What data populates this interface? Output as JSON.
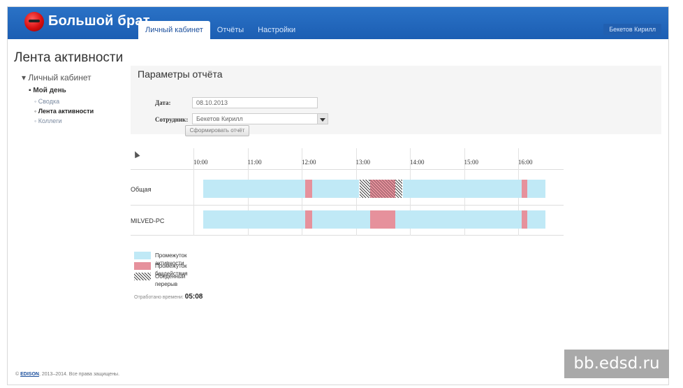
{
  "app": {
    "brand": "Большой брат",
    "tabs": [
      {
        "label": "Личный кабинет",
        "active": true
      },
      {
        "label": "Отчёты",
        "active": false
      },
      {
        "label": "Настройки",
        "active": false
      }
    ],
    "user": "Бекетов Кирилл"
  },
  "page_title": "Лента активности",
  "sidebar": {
    "root": "Личный кабинет",
    "group": "Мой день",
    "items": [
      {
        "label": "Сводка",
        "current": false
      },
      {
        "label": "Лента активности",
        "current": true
      },
      {
        "label": "Коллеги",
        "current": false
      }
    ]
  },
  "params": {
    "title": "Параметры отчёта",
    "date_label": "Дата:",
    "date_value": "08.10.2013",
    "employee_label": "Сотрудник:",
    "employee_value": "Бекетов Кирилл",
    "generate_label": "Сформировать отчёт"
  },
  "timeline": {
    "ticks": [
      "10:00",
      "11:00",
      "12:00",
      "13:00",
      "14:00",
      "15:00",
      "16:00"
    ],
    "rows": [
      {
        "name": "Общая",
        "segments": [
          {
            "type": "active",
            "start": "10:07",
            "end": "12:00"
          },
          {
            "type": "idle",
            "start": "12:00",
            "end": "12:08"
          },
          {
            "type": "active",
            "start": "12:08",
            "end": "13:00"
          },
          {
            "type": "lunch",
            "start": "13:00",
            "end": "13:12"
          },
          {
            "type": "lunch-idle",
            "start": "13:12",
            "end": "13:40"
          },
          {
            "type": "lunch",
            "start": "13:40",
            "end": "13:48"
          },
          {
            "type": "active",
            "start": "13:48",
            "end": "16:00"
          },
          {
            "type": "idle",
            "start": "16:00",
            "end": "16:06"
          },
          {
            "type": "active",
            "start": "16:06",
            "end": "16:26"
          }
        ]
      },
      {
        "name": "MILVED-PC",
        "segments": [
          {
            "type": "active",
            "start": "10:07",
            "end": "12:00"
          },
          {
            "type": "idle",
            "start": "12:00",
            "end": "12:08"
          },
          {
            "type": "active",
            "start": "12:08",
            "end": "13:12"
          },
          {
            "type": "idle",
            "start": "13:12",
            "end": "13:40"
          },
          {
            "type": "active",
            "start": "13:40",
            "end": "16:00"
          },
          {
            "type": "idle",
            "start": "16:00",
            "end": "16:06"
          },
          {
            "type": "active",
            "start": "16:06",
            "end": "16:26"
          }
        ]
      }
    ]
  },
  "legend": [
    {
      "type": "active",
      "label": "Промежуток активности"
    },
    {
      "type": "idle",
      "label": "Промежуток бездействия"
    },
    {
      "type": "lunch",
      "label": "Обеденный перерыв"
    }
  ],
  "worked": {
    "label": "Отработано времени:",
    "value": "05:08"
  },
  "footer": {
    "prefix": "©",
    "link": "EDISON",
    "text": ", 2013–2014. Все права защищены."
  },
  "watermark": "bb.edsd.ru"
}
